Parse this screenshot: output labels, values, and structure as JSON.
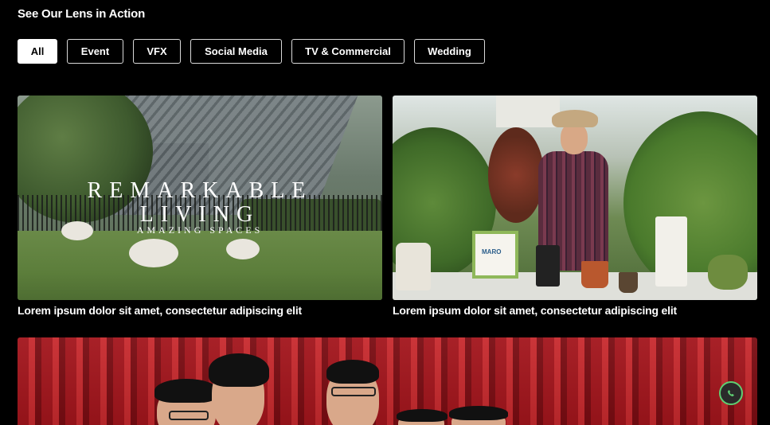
{
  "section": {
    "title": "See Our Lens in Action"
  },
  "filters": [
    {
      "label": "All",
      "active": true
    },
    {
      "label": "Event",
      "active": false
    },
    {
      "label": "VFX",
      "active": false
    },
    {
      "label": "Social Media",
      "active": false
    },
    {
      "label": "TV & Commercial",
      "active": false
    },
    {
      "label": "Wedding",
      "active": false
    }
  ],
  "cards": [
    {
      "caption": "Lorem ipsum dolor sit amet, consectetur adipiscing elit",
      "overlay": {
        "line1": "REMARKABLE",
        "line2": "LIVING",
        "line3": "AMAZING SPACES"
      }
    },
    {
      "caption": "Lorem ipsum dolor sit amet, consectetur adipiscing elit",
      "sign_text": "MARO"
    },
    {
      "caption": ""
    }
  ],
  "floating": {
    "icon": "whatsapp-icon"
  },
  "colors": {
    "accent_active_bg": "#ffffff",
    "background": "#000000",
    "whatsapp_green": "#5fcf73"
  }
}
